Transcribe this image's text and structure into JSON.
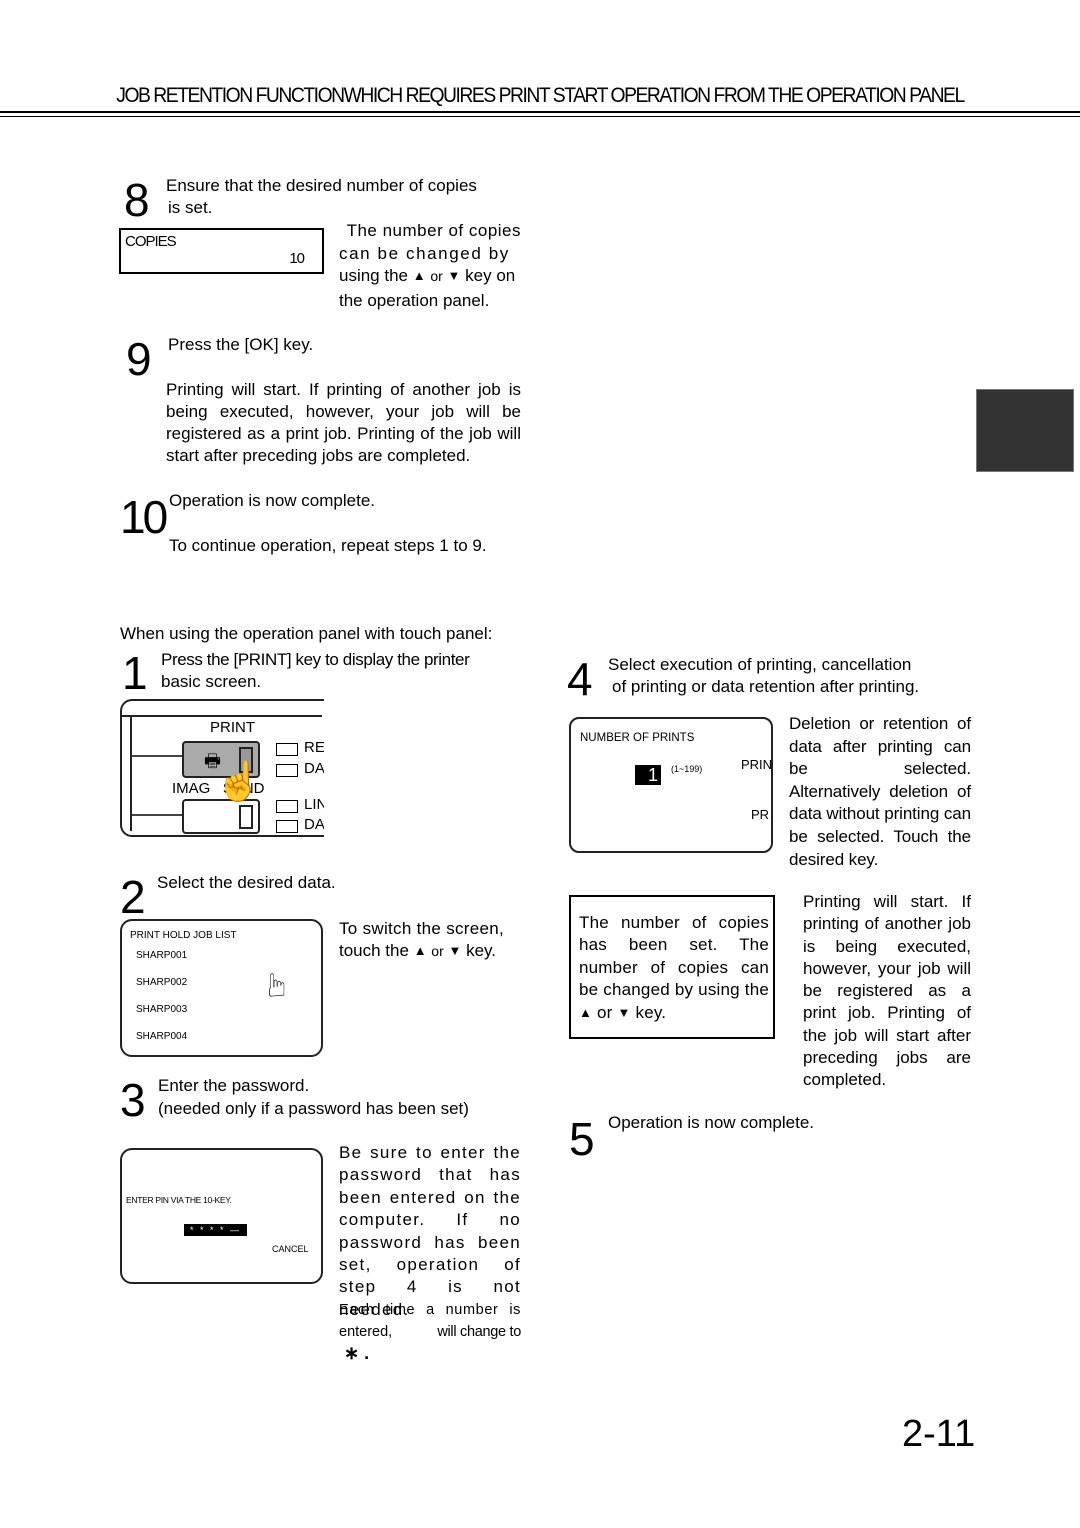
{
  "header": {
    "title": "JOB RETENTION FUNCTIONWHICH REQUIRES PRINT START OPERATION FROM THE OPERATION PANEL"
  },
  "steps_left_top": {
    "step8": {
      "number": "8",
      "text_line1": "Ensure that the desired number of copies",
      "text_line2": "is set.",
      "lcd": {
        "label": "COPIES",
        "value": "10"
      },
      "note": [
        "The number of copies",
        "can be changed by",
        "using the",
        "or",
        "key on",
        "the operation panel."
      ]
    },
    "step9": {
      "number": "9",
      "text": "Press the [OK] key.",
      "note": "Printing will start. If printing of another job is being executed, however, your job will be registered as a print job. Printing of the job will start after preceding jobs are completed."
    },
    "step10": {
      "number": "10",
      "text": "Operation is now complete.",
      "note": "To continue operation, repeat steps 1 to 9."
    }
  },
  "touch_panel": {
    "intro": "When using the operation panel with touch panel:",
    "step1": {
      "number": "1",
      "text_line1": "Press the [PRINT] key to display the printer",
      "text_line2": "basic screen.",
      "panel": {
        "print_label": "PRINT",
        "image_send_label": "IMAG   SEND",
        "leds": [
          "RE",
          "DA",
          "LIN",
          "DA"
        ]
      }
    },
    "step2": {
      "number": "2",
      "text": "Select the desired data.",
      "lcd": {
        "title": "PRINT HOLD JOB LIST",
        "items": [
          "SHARP001",
          "SHARP002",
          "SHARP003",
          "SHARP004"
        ]
      },
      "note": [
        "To switch the screen,",
        "touch the",
        "or",
        "key."
      ]
    },
    "step3": {
      "number": "3",
      "text_line1": "Enter the password.",
      "text_line2": "(needed only if a password has been set)",
      "lcd": {
        "prompt": "ENTER PIN VIA THE 10-KEY.",
        "pin": "* * * * —",
        "cancel": "CANCEL"
      },
      "note": "Be sure to enter the password that has been entered on the computer. If no password has been set, operation of step 4 is not needed.",
      "note2": [
        "Each time a number is",
        "entered,",
        "will change to"
      ],
      "asterisk": "∗ ."
    },
    "step4": {
      "number": "4",
      "text_line1": "Select execution of printing, cancellation",
      "text_line2": "of printing or data retention after printing.",
      "lcd": {
        "title": "NUMBER OF PRINTS",
        "value": "1",
        "range": "(1~199)",
        "opt1": "PRIN",
        "opt2": "PR"
      },
      "note": "Deletion or retention of data after printing can be selected. Alternatively deletion of data without printing can be selected. Touch the desired key.",
      "box_note": [
        "The number of copies has been set. The number of copies can be changed by using the",
        "or",
        "key."
      ],
      "note2": "Printing will start. If printing of another job is being executed, however, your job will be registered as a print job. Printing of the job will start after preceding jobs are completed."
    },
    "step5": {
      "number": "5",
      "text": "Operation is now complete."
    }
  },
  "icons": {
    "up": "▲",
    "down": "▼"
  },
  "page_number": "2-11"
}
